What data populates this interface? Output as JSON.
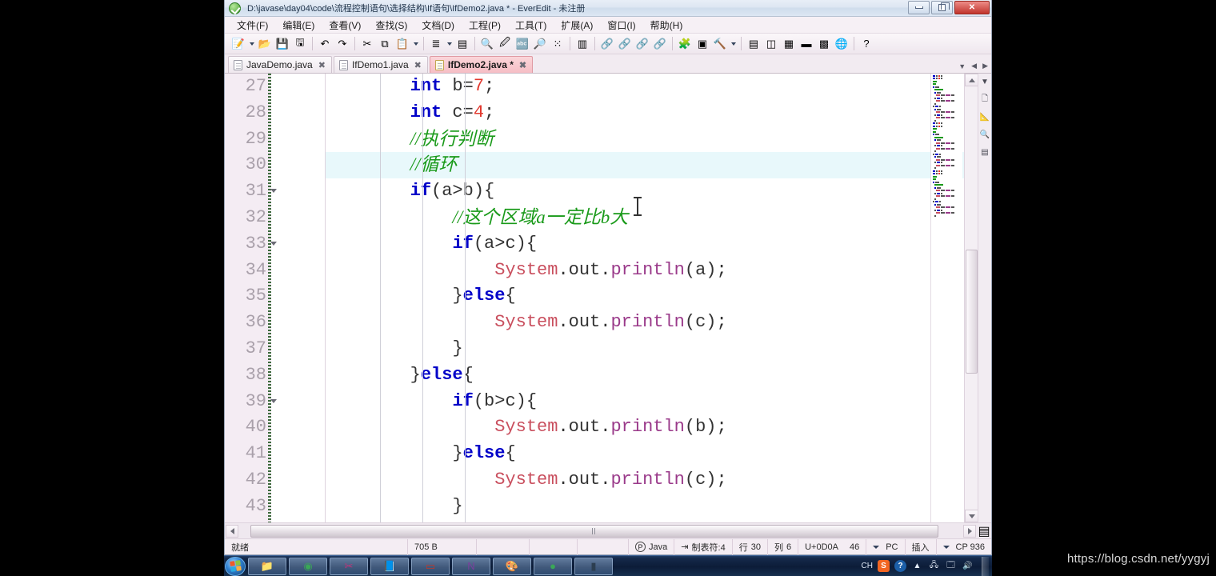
{
  "window": {
    "title": "D:\\javase\\day04\\code\\流程控制语句\\选择结构\\If语句\\IfDemo2.java * - EverEdit - 未注册",
    "app_icon": "everedit-green-check-icon",
    "controls": {
      "minimize": "─",
      "maximize": "❐",
      "close": "✕"
    }
  },
  "menubar": {
    "items": [
      {
        "label": "文件(F)"
      },
      {
        "label": "编辑(E)"
      },
      {
        "label": "查看(V)"
      },
      {
        "label": "查找(S)"
      },
      {
        "label": "文档(D)"
      },
      {
        "label": "工程(P)"
      },
      {
        "label": "工具(T)"
      },
      {
        "label": "扩展(A)"
      },
      {
        "label": "窗口(I)"
      },
      {
        "label": "帮助(H)"
      }
    ]
  },
  "toolbar": {
    "groups": [
      {
        "buttons": [
          {
            "name": "new-file-icon",
            "glyph": "📝",
            "dropdown": true
          },
          {
            "name": "open-folder-icon",
            "glyph": "📂",
            "dropdown": false
          },
          {
            "name": "save-icon",
            "glyph": "💾",
            "dropdown": false
          },
          {
            "name": "save-all-icon",
            "glyph": "🖫",
            "dropdown": false
          }
        ]
      },
      {
        "buttons": [
          {
            "name": "undo-icon",
            "glyph": "↶",
            "dropdown": false
          },
          {
            "name": "redo-icon",
            "glyph": "↷",
            "dropdown": false
          }
        ]
      },
      {
        "buttons": [
          {
            "name": "cut-icon",
            "glyph": "✂",
            "dropdown": false
          },
          {
            "name": "copy-icon",
            "glyph": "⧉",
            "dropdown": false
          },
          {
            "name": "paste-icon",
            "glyph": "📋",
            "dropdown": true
          }
        ]
      },
      {
        "buttons": [
          {
            "name": "indent-lines-icon",
            "glyph": "≣",
            "dropdown": true
          },
          {
            "name": "word-wrap-icon",
            "glyph": "▤",
            "dropdown": false
          }
        ]
      },
      {
        "buttons": [
          {
            "name": "find-icon",
            "glyph": "🔍",
            "dropdown": false
          },
          {
            "name": "replace-icon",
            "glyph": "🖉",
            "dropdown": false
          },
          {
            "name": "sort-abc-icon",
            "glyph": "🔤",
            "dropdown": false
          },
          {
            "name": "find-in-files-icon",
            "glyph": "🔎",
            "dropdown": false
          },
          {
            "name": "compare-icon",
            "glyph": "⁙",
            "dropdown": false
          }
        ]
      },
      {
        "buttons": [
          {
            "name": "column-mode-icon",
            "glyph": "▥",
            "dropdown": false
          }
        ]
      },
      {
        "buttons": [
          {
            "name": "bookmark-toggle-icon",
            "glyph": "🔗",
            "dropdown": false
          },
          {
            "name": "bookmark-next-icon",
            "glyph": "🔗",
            "dropdown": false
          },
          {
            "name": "bookmark-prev-icon",
            "glyph": "🔗",
            "dropdown": false
          },
          {
            "name": "bookmark-clear-icon",
            "glyph": "🔗",
            "dropdown": false
          }
        ]
      },
      {
        "buttons": [
          {
            "name": "plugin-icon",
            "glyph": "🧩",
            "dropdown": false
          },
          {
            "name": "panel-icon",
            "glyph": "▣",
            "dropdown": false
          },
          {
            "name": "build-tool-icon",
            "glyph": "🔨",
            "dropdown": true
          }
        ]
      },
      {
        "buttons": [
          {
            "name": "explorer-panel-icon",
            "glyph": "▤",
            "dropdown": false
          },
          {
            "name": "project-panel-icon",
            "glyph": "◫",
            "dropdown": false
          },
          {
            "name": "outline-panel-icon",
            "glyph": "▦",
            "dropdown": false
          },
          {
            "name": "console-panel-icon",
            "glyph": "▬",
            "dropdown": false
          },
          {
            "name": "grid-panel-icon",
            "glyph": "▩",
            "dropdown": false
          },
          {
            "name": "browser-icon",
            "glyph": "🌐",
            "dropdown": false
          }
        ]
      },
      {
        "buttons": [
          {
            "name": "help-icon",
            "glyph": "?",
            "dropdown": false
          }
        ]
      }
    ]
  },
  "tabs": {
    "items": [
      {
        "label": "JavaDemo.java",
        "active": false,
        "modified": false
      },
      {
        "label": "IfDemo1.java",
        "active": false,
        "modified": false
      },
      {
        "label": "IfDemo2.java *",
        "active": true,
        "modified": true
      }
    ],
    "close_glyph": "✖",
    "right_controls": [
      {
        "name": "tab-list-dropdown-icon",
        "glyph": "▼"
      },
      {
        "name": "tab-scroll-left-icon",
        "glyph": "◀"
      },
      {
        "name": "tab-scroll-right-icon",
        "glyph": "▶"
      }
    ]
  },
  "editor": {
    "current_line": 30,
    "lines": [
      {
        "no": "27",
        "fold": false,
        "current": false,
        "indent_guides": 1,
        "tokens": [
          {
            "t": "        ",
            "c": "pn"
          },
          {
            "t": "int",
            "c": "kw"
          },
          {
            "t": " b=",
            "c": "pn"
          },
          {
            "t": "7",
            "c": "num"
          },
          {
            "t": ";",
            "c": "pn"
          }
        ]
      },
      {
        "no": "28",
        "fold": false,
        "current": false,
        "indent_guides": 1,
        "tokens": [
          {
            "t": "        ",
            "c": "pn"
          },
          {
            "t": "int",
            "c": "kw"
          },
          {
            "t": " c=",
            "c": "pn"
          },
          {
            "t": "4",
            "c": "num"
          },
          {
            "t": ";",
            "c": "pn"
          }
        ]
      },
      {
        "no": "29",
        "fold": false,
        "current": false,
        "indent_guides": 1,
        "tokens": [
          {
            "t": "        ",
            "c": "pn"
          },
          {
            "t": "//执行判断",
            "c": "cmt"
          }
        ]
      },
      {
        "no": "30",
        "fold": false,
        "current": true,
        "indent_guides": 1,
        "tokens": [
          {
            "t": "        ",
            "c": "pn"
          },
          {
            "t": "//循环",
            "c": "cmt"
          }
        ]
      },
      {
        "no": "31",
        "fold": true,
        "current": false,
        "indent_guides": 1,
        "tokens": [
          {
            "t": "        ",
            "c": "pn"
          },
          {
            "t": "if",
            "c": "kw"
          },
          {
            "t": "(a>b){",
            "c": "pn"
          }
        ]
      },
      {
        "no": "32",
        "fold": false,
        "current": false,
        "indent_guides": 2,
        "tokens": [
          {
            "t": "            ",
            "c": "pn"
          },
          {
            "t": "//这个区域a一定比b大",
            "c": "cmt"
          }
        ]
      },
      {
        "no": "33",
        "fold": true,
        "current": false,
        "indent_guides": 2,
        "tokens": [
          {
            "t": "            ",
            "c": "pn"
          },
          {
            "t": "if",
            "c": "kw"
          },
          {
            "t": "(a>c){",
            "c": "pn"
          }
        ]
      },
      {
        "no": "34",
        "fold": false,
        "current": false,
        "indent_guides": 3,
        "tokens": [
          {
            "t": "                ",
            "c": "pn"
          },
          {
            "t": "System",
            "c": "cls"
          },
          {
            "t": ".out.",
            "c": "pn"
          },
          {
            "t": "println",
            "c": "mth"
          },
          {
            "t": "(a);",
            "c": "pn"
          }
        ]
      },
      {
        "no": "35",
        "fold": false,
        "current": false,
        "indent_guides": 2,
        "tokens": [
          {
            "t": "            ",
            "c": "pn"
          },
          {
            "t": "}",
            "c": "pn"
          },
          {
            "t": "else",
            "c": "kw"
          },
          {
            "t": "{",
            "c": "pn"
          }
        ]
      },
      {
        "no": "36",
        "fold": false,
        "current": false,
        "indent_guides": 3,
        "tokens": [
          {
            "t": "                ",
            "c": "pn"
          },
          {
            "t": "System",
            "c": "cls"
          },
          {
            "t": ".out.",
            "c": "pn"
          },
          {
            "t": "println",
            "c": "mth"
          },
          {
            "t": "(c);",
            "c": "pn"
          }
        ]
      },
      {
        "no": "37",
        "fold": false,
        "current": false,
        "indent_guides": 2,
        "tokens": [
          {
            "t": "            ",
            "c": "pn"
          },
          {
            "t": "}",
            "c": "pn"
          }
        ]
      },
      {
        "no": "38",
        "fold": false,
        "current": false,
        "indent_guides": 1,
        "tokens": [
          {
            "t": "        ",
            "c": "pn"
          },
          {
            "t": "}",
            "c": "pn"
          },
          {
            "t": "else",
            "c": "kw"
          },
          {
            "t": "{",
            "c": "pn"
          }
        ]
      },
      {
        "no": "39",
        "fold": true,
        "current": false,
        "indent_guides": 2,
        "tokens": [
          {
            "t": "            ",
            "c": "pn"
          },
          {
            "t": "if",
            "c": "kw"
          },
          {
            "t": "(b>c){",
            "c": "pn"
          }
        ]
      },
      {
        "no": "40",
        "fold": false,
        "current": false,
        "indent_guides": 3,
        "tokens": [
          {
            "t": "                ",
            "c": "pn"
          },
          {
            "t": "System",
            "c": "cls"
          },
          {
            "t": ".out.",
            "c": "pn"
          },
          {
            "t": "println",
            "c": "mth"
          },
          {
            "t": "(b);",
            "c": "pn"
          }
        ]
      },
      {
        "no": "41",
        "fold": false,
        "current": false,
        "indent_guides": 2,
        "tokens": [
          {
            "t": "            ",
            "c": "pn"
          },
          {
            "t": "}",
            "c": "pn"
          },
          {
            "t": "else",
            "c": "kw"
          },
          {
            "t": "{",
            "c": "pn"
          }
        ]
      },
      {
        "no": "42",
        "fold": false,
        "current": false,
        "indent_guides": 3,
        "tokens": [
          {
            "t": "                ",
            "c": "pn"
          },
          {
            "t": "System",
            "c": "cls"
          },
          {
            "t": ".out.",
            "c": "pn"
          },
          {
            "t": "println",
            "c": "mth"
          },
          {
            "t": "(c);",
            "c": "pn"
          }
        ]
      },
      {
        "no": "43",
        "fold": false,
        "current": false,
        "indent_guides": 2,
        "tokens": [
          {
            "t": "            ",
            "c": "pn"
          },
          {
            "t": "}",
            "c": "pn"
          }
        ]
      }
    ]
  },
  "right_strip": {
    "items": [
      {
        "name": "panel-dropdown-icon",
        "glyph": "▼"
      },
      {
        "name": "document-map-icon",
        "glyph": "🗋"
      },
      {
        "name": "ruler-icon",
        "glyph": "📐"
      },
      {
        "name": "search-panel-icon",
        "glyph": "🔍"
      },
      {
        "name": "outline-panel-icon",
        "glyph": "▤"
      }
    ]
  },
  "statusbar": {
    "ready": "就绪",
    "size": "705 B",
    "language": "Java",
    "language_badge": "P",
    "tab_setting": "制表符:4",
    "tab_icon": "tab-arrow-icon",
    "line_label": "行",
    "line_value": "30",
    "col_label": "列",
    "col_value": "6",
    "encoding_code": "U+0D0A",
    "char_code": "46",
    "line_ending": "PC",
    "insert_mode": "插入",
    "codepage": "CP 936"
  },
  "scrollbars": {
    "vertical": {
      "up": "▲",
      "down": "▼"
    },
    "horizontal": {
      "left": "◀",
      "right": "▶"
    }
  },
  "taskbar": {
    "start": "windows-start-orb",
    "items": [
      {
        "name": "taskbar-explorer-icon",
        "glyph": "📁"
      },
      {
        "name": "taskbar-chrome-icon",
        "glyph": "◉"
      },
      {
        "name": "taskbar-snipping-icon",
        "glyph": "✂"
      },
      {
        "name": "taskbar-notepad-icon",
        "glyph": "📘"
      },
      {
        "name": "taskbar-recorder-icon",
        "glyph": "▭"
      },
      {
        "name": "taskbar-onenote-icon",
        "glyph": "N"
      },
      {
        "name": "taskbar-paint-icon",
        "glyph": "🎨"
      },
      {
        "name": "taskbar-everedit-icon",
        "glyph": "●"
      },
      {
        "name": "taskbar-cmd-icon",
        "glyph": "▮"
      }
    ],
    "tray": {
      "ime": "CH",
      "icons": [
        {
          "name": "sogou-input-icon",
          "glyph": "S"
        },
        {
          "name": "help-tray-icon",
          "glyph": "?"
        },
        {
          "name": "expand-tray-icon",
          "glyph": "▲"
        },
        {
          "name": "network-error-icon",
          "glyph": "🖧"
        },
        {
          "name": "battery-icon",
          "glyph": "🗔"
        },
        {
          "name": "volume-icon",
          "glyph": "🔊"
        }
      ]
    }
  },
  "watermark": "https://blog.csdn.net/yygyj",
  "colors": {
    "keyword": "#0000c8",
    "number": "#e2382e",
    "comment": "#1a9a1a",
    "class": "#c94f5e",
    "method": "#9a3a8a",
    "current_line_bg": "#e8f8fb",
    "active_tab_bg": "#f6bec5"
  }
}
